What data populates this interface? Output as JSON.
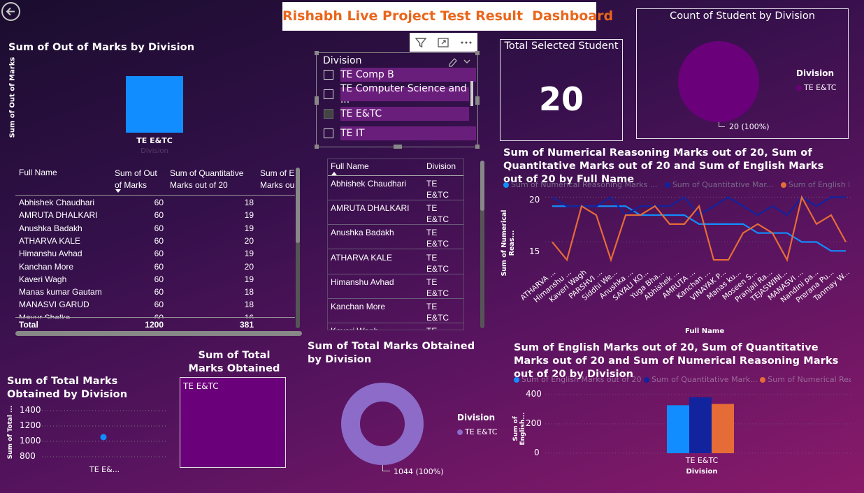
{
  "header": {
    "title": "Rishabh Live Project Test Result  Dashboard"
  },
  "colors": {
    "accent": "#e9661b",
    "blue": "#118dff",
    "darkblue": "#12239e",
    "orange": "#e66c37",
    "purple": "#6b007b",
    "lavender": "#8d6bc9"
  },
  "out_marks_chart": {
    "title": "Sum of Out of Marks by Division",
    "ylabel": "Sum of Out of Marks",
    "xlabel": "Division",
    "category": "TE E&TC"
  },
  "table1": {
    "headers": [
      "Full Name",
      "Sum of Out of Marks",
      "Sum of Quantitative Marks out of 20",
      "Sum of E Marks ou"
    ],
    "header_lines": [
      [
        "Full Name"
      ],
      [
        "Sum of Out",
        "of Marks"
      ],
      [
        "Sum of Quantitative",
        "Marks out of 20"
      ],
      [
        "Sum of E",
        "Marks ou"
      ]
    ],
    "rows": [
      [
        "Abhishek Chaudhari",
        "60",
        "18"
      ],
      [
        "AMRUTA DHALKARI",
        "60",
        "19"
      ],
      [
        "Anushka Badakh",
        "60",
        "19"
      ],
      [
        "ATHARVA KALE",
        "60",
        "20"
      ],
      [
        "Himanshu Avhad",
        "60",
        "19"
      ],
      [
        "Kanchan More",
        "60",
        "20"
      ],
      [
        "Kaveri Wagh",
        "60",
        "19"
      ],
      [
        "Manas kumar Gautam",
        "60",
        "18"
      ],
      [
        "MANASVI GARUD",
        "60",
        "18"
      ],
      [
        "Mayur Shelke",
        "60",
        "16"
      ]
    ],
    "total": [
      "Total",
      "1200",
      "381"
    ]
  },
  "slicer": {
    "title": "Division",
    "items": [
      {
        "label": "TE Comp B",
        "checked": false
      },
      {
        "label": "TE Computer Science and ...",
        "checked": false
      },
      {
        "label": "TE E&TC",
        "checked": true
      },
      {
        "label": "TE IT",
        "checked": false
      }
    ]
  },
  "table2": {
    "headers": [
      "Full Name",
      "Division"
    ],
    "rows": [
      [
        "Abhishek Chaudhari",
        "TE",
        "E&TC"
      ],
      [
        "AMRUTA DHALKARI",
        "TE",
        "E&TC"
      ],
      [
        "Anushka Badakh",
        "TE",
        "E&TC"
      ],
      [
        "ATHARVA KALE",
        "TE",
        "E&TC"
      ],
      [
        "Himanshu Avhad",
        "TE",
        "E&TC"
      ],
      [
        "Kanchan More",
        "TE",
        "E&TC"
      ],
      [
        "Kaveri Wagh",
        "TE",
        ""
      ]
    ]
  },
  "card": {
    "title": "Total Selected Student",
    "value": "20"
  },
  "pie": {
    "title": "Count of Student by Division",
    "legend_title": "Division",
    "legend_item": "TE E&TC",
    "label": "20 (100%)"
  },
  "line": {
    "title": "Sum of Numerical Reasoning Marks out of 20, Sum of Quantitative Marks out of 20 and Sum of English Marks out of 20 by Full Name",
    "legend": [
      "Sum of Numerical Reasoning Marks ...",
      "Sum of  Quantitative   Mar...",
      "Sum of English Mar..."
    ],
    "ylabel": "Sum of Numerical Reas...",
    "xlabel": "Full Name",
    "yticks": [
      "20",
      "15"
    ],
    "categories": [
      "ATHARVA ...",
      "Himanshu ...",
      "Kaveri Wagh",
      "PARSHVI ...",
      "Siddhi We...",
      "Anushka ...",
      "SAYALI KO...",
      "Yuga Bha...",
      "Abhishek ...",
      "AMRUTA ...",
      "Kanchan ...",
      "VINAYAK P...",
      "Manas ku...",
      "Moseen S...",
      "Pranjali Ra...",
      "TEJASWINI...",
      "MANASVI ...",
      "Nandini pa...",
      "Prerana Pu...",
      "Tanmay W..."
    ]
  },
  "chart_data": [
    {
      "type": "bar",
      "title": "Sum of Out of Marks by Division",
      "categories": [
        "TE E&TC"
      ],
      "values": [
        1200
      ],
      "ylabel": "Sum of Out of Marks",
      "xlabel": "Division"
    },
    {
      "type": "pie",
      "title": "Count of Student by Division",
      "categories": [
        "TE E&TC"
      ],
      "values": [
        20
      ]
    },
    {
      "type": "line",
      "title": "Sum of Numerical Reasoning Marks out of 20, Sum of Quantitative Marks out of 20 and Sum of English Marks out of 20 by Full Name",
      "categories": [
        "ATHARVA ...",
        "Himanshu ...",
        "Kaveri Wagh",
        "PARSHVI ...",
        "Siddhi We...",
        "Anushka ...",
        "SAYALI KO...",
        "Yuga Bha...",
        "Abhishek ...",
        "AMRUTA ...",
        "Kanchan ...",
        "VINAYAK P...",
        "Manas ku...",
        "Moseen S...",
        "Pranjali Ra...",
        "TEJASWINI...",
        "MANASVI ...",
        "Nandini pa...",
        "Prerana Pu...",
        "Tanmay W..."
      ],
      "ylim": [
        12.7,
        20.5
      ],
      "series": [
        {
          "name": "Sum of Numerical Reasoning Marks ...",
          "color": "#118dff",
          "values": [
            19,
            19,
            19,
            19,
            19,
            19,
            18,
            18,
            18,
            18,
            17,
            17,
            17,
            17,
            16,
            16,
            16,
            15,
            15,
            14,
            14
          ]
        },
        {
          "name": "Sum of  Quantitative   Mar...",
          "color": "#12239e",
          "values": [
            20,
            19,
            19,
            19,
            20,
            18,
            19,
            19,
            19,
            20,
            18,
            19,
            20,
            19,
            18,
            19,
            18,
            20,
            19,
            20,
            20
          ]
        },
        {
          "name": "Sum of English Mar...",
          "color": "#e66c37",
          "values": [
            15,
            13,
            19,
            18,
            13,
            18,
            18,
            19,
            17,
            17,
            19,
            13,
            13,
            16,
            17,
            16,
            13,
            20,
            17,
            18,
            15
          ]
        }
      ]
    },
    {
      "type": "line",
      "title": "Sum of Total Marks Obtained by Division",
      "categories": [
        "TE E&..."
      ],
      "values": [
        1044
      ],
      "ylim": [
        800,
        1400
      ],
      "yticks": [
        "1400",
        "1200",
        "1000",
        "800"
      ],
      "ylabel": "Sum of Total ..."
    },
    {
      "type": "pie",
      "title": "Sum of Total Marks Obtained by Division",
      "categories": [
        "TE E&TC"
      ],
      "values": [
        1044
      ],
      "label": "1044 (100%)"
    },
    {
      "type": "bar",
      "title": "Sum of English Marks out of 20, Sum of Quantitative Marks out of 20 and Sum of Numerical Reasoning Marks out of 20 by Division",
      "categories": [
        "TE E&TC"
      ],
      "ylim": [
        0,
        400
      ],
      "yticks": [
        "400",
        "200",
        "0"
      ],
      "series": [
        {
          "name": "Sum of English Marks out of 20",
          "color": "#118dff",
          "values": [
            327
          ]
        },
        {
          "name": "Sum of  Quantitative   Mark...",
          "color": "#12239e",
          "values": [
            381
          ]
        },
        {
          "name": "Sum of Numerical Rea...",
          "color": "#e66c37",
          "values": [
            336
          ]
        }
      ],
      "xlabel": "Division",
      "ylabel": "Sum of English..."
    }
  ],
  "total_line": {
    "title": "Sum of Total Marks Obtained by Division",
    "ylabel": "Sum of Total ...",
    "yticks": [
      "1400",
      "1200",
      "1000",
      "800"
    ],
    "category": "TE E&..."
  },
  "treemap": {
    "title": "Sum of Total Marks Obtained by Division",
    "label": "TE E&TC"
  },
  "donut": {
    "title": "Sum of Total Marks Obtained by Division",
    "legend_title": "Division",
    "legend_item": "TE E&TC",
    "label": "1044 (100%)"
  },
  "clustered": {
    "title": "Sum of English Marks out of 20, Sum of Quantitative Marks out of 20 and Sum of Numerical Reasoning Marks out of 20 by Division",
    "legend": [
      "Sum of English Marks out of 20",
      "Sum of  Quantitative   Mark...",
      "Sum of Numerical Rea..."
    ],
    "ylabel": "Sum of English...",
    "xlabel": "Division",
    "category": "TE E&TC",
    "yticks": [
      "400",
      "200",
      "0"
    ]
  }
}
